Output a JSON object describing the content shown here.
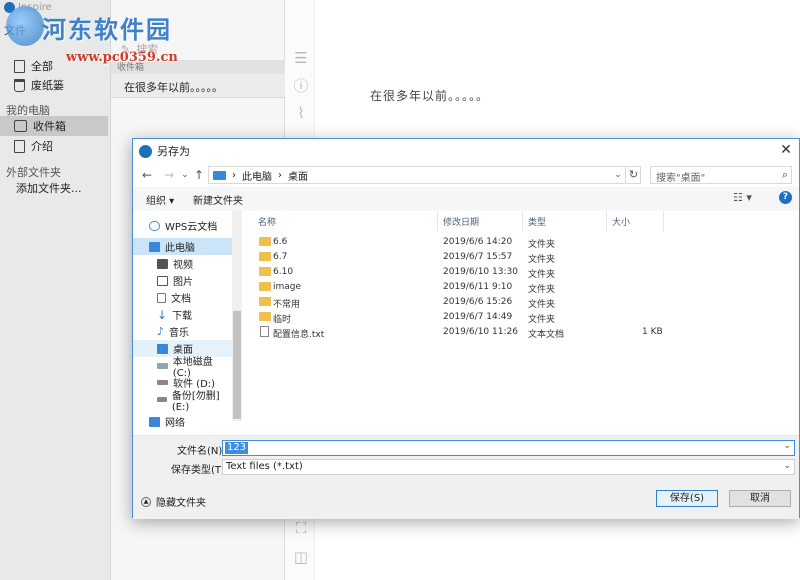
{
  "watermark": {
    "brand": "河东软件园",
    "url": "www.pc0359.cn"
  },
  "app": {
    "title": "Inspire",
    "menu": "文件",
    "sidebar": {
      "items": [
        {
          "label": "全部"
        },
        {
          "label": "废纸篓"
        }
      ],
      "my_computer_header": "我的电脑",
      "computer_items": [
        {
          "label": "收件箱"
        },
        {
          "label": "介绍"
        }
      ],
      "external_header": "外部文件夹",
      "add_folder": "添加文件夹..."
    },
    "list": {
      "search_placeholder": "搜索",
      "header": "收件箱",
      "item_text": "在很多年以前。。。。。"
    },
    "editor": {
      "text": "在很多年以前。。。。。"
    }
  },
  "dialog": {
    "title": "另存为",
    "close": "✕",
    "nav": {
      "back": "←",
      "forward": "→",
      "recent": "⌄",
      "up": "↑"
    },
    "address": {
      "sep": "›",
      "pc": "此电脑",
      "desktop": "桌面"
    },
    "search_placeholder": "搜索\"桌面\"",
    "toolbar": {
      "organize": "组织 ▾",
      "new_folder": "新建文件夹",
      "help": "?"
    },
    "nav_pane": [
      {
        "label": "WPS云文档",
        "icon": "cloud-icon"
      },
      {
        "label": "此电脑",
        "icon": "pc-icon"
      },
      {
        "label": "视频",
        "icon": "video-icon"
      },
      {
        "label": "图片",
        "icon": "image-icon"
      },
      {
        "label": "文档",
        "icon": "document-icon"
      },
      {
        "label": "下载",
        "icon": "download-icon"
      },
      {
        "label": "音乐",
        "icon": "music-icon"
      },
      {
        "label": "桌面",
        "icon": "desktop-icon"
      },
      {
        "label": "本地磁盘 (C:)",
        "icon": "drive-icon"
      },
      {
        "label": "软件 (D:)",
        "icon": "drive-icon"
      },
      {
        "label": "备份[勿删] (E:)",
        "icon": "drive-icon"
      },
      {
        "label": "网络",
        "icon": "network-icon"
      }
    ],
    "columns": {
      "name": "名称",
      "modified": "修改日期",
      "type": "类型",
      "size": "大小"
    },
    "files": [
      {
        "name": "6.6",
        "modified": "2019/6/6 14:20",
        "type": "文件夹",
        "size": "",
        "kind": "folder"
      },
      {
        "name": "6.7",
        "modified": "2019/6/7 15:57",
        "type": "文件夹",
        "size": "",
        "kind": "folder"
      },
      {
        "name": "6.10",
        "modified": "2019/6/10 13:30",
        "type": "文件夹",
        "size": "",
        "kind": "folder"
      },
      {
        "name": "image",
        "modified": "2019/6/11 9:10",
        "type": "文件夹",
        "size": "",
        "kind": "folder"
      },
      {
        "name": "不常用",
        "modified": "2019/6/6 15:26",
        "type": "文件夹",
        "size": "",
        "kind": "folder"
      },
      {
        "name": "临时",
        "modified": "2019/6/7 14:49",
        "type": "文件夹",
        "size": "",
        "kind": "folder"
      },
      {
        "name": "配置信息.txt",
        "modified": "2019/6/10 11:26",
        "type": "文本文档",
        "size": "1 KB",
        "kind": "file"
      }
    ],
    "filename_label": "文件名(N):",
    "filename_value": "123",
    "filetype_label": "保存类型(T):",
    "filetype_value": "Text files (*.txt)",
    "hide_folders": "隐藏文件夹",
    "save": "保存(S)",
    "cancel": "取消"
  },
  "colors": {
    "accent": "#3d8ee0",
    "folder": "#f0c04a",
    "selection": "#cce4f7"
  }
}
